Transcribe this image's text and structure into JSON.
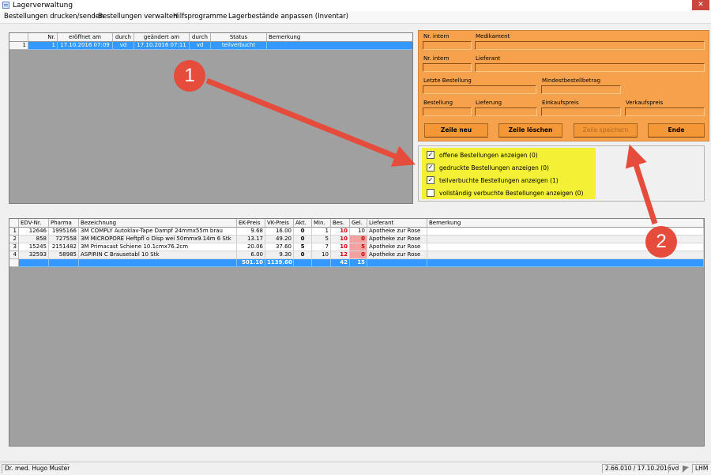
{
  "window": {
    "title": "Lagerverwaltung",
    "close_symbol": "✕"
  },
  "menu": [
    {
      "label": "Bestellungen drucken/senden"
    },
    {
      "label": "Bestellungen verwalten"
    },
    {
      "label": "Hilfsprogramme"
    },
    {
      "label": "Lagerbestände anpassen (Inventar)"
    }
  ],
  "orders_table": {
    "columns": [
      "Nr.",
      "eröffnet am",
      "durch",
      "geändert am",
      "durch",
      "Status",
      "Bemerkung"
    ],
    "rows": [
      {
        "idx": "1",
        "nr": "1",
        "opened": "17.10.2016 07:09",
        "by1": "vd",
        "changed": "17.10.2016 07:11",
        "by2": "vd",
        "status": "teilverbucht",
        "note": ""
      }
    ]
  },
  "form": {
    "labels": {
      "nr_intern_1": "Nr. intern",
      "medikament": "Medikament",
      "nr_intern_2": "Nr. intern",
      "lieferant": "Lieferant",
      "letzte_bestellung": "Letzte Bestellung",
      "mindestbestellbetrag": "Mindestbestellbetrag",
      "bestellung": "Bestellung",
      "lieferung": "Lieferung",
      "einkaufspreis": "Einkaufspreis",
      "verkaufspreis": "Verkaufspreis"
    },
    "buttons": {
      "zeile_neu": "Zeile neu",
      "zeile_loeschen": "Zeile löschen",
      "zeile_speichern": "Zeile speichern",
      "ende": "Ende"
    }
  },
  "filters": [
    {
      "label": "offene Bestellungen anzeigen (0)",
      "checked": true
    },
    {
      "label": "gedruckte Bestellungen anzeigen (0)",
      "checked": true
    },
    {
      "label": "teilverbuchte Bestellungen anzeigen (1)",
      "checked": true
    },
    {
      "label": "vollständig verbuchte Bestellungen anzeigen (0)",
      "checked": false
    }
  ],
  "items_table": {
    "columns": [
      "EDV-Nr.",
      "Pharma",
      "Bezeichnung",
      "EK-Preis",
      "VK-Preis",
      "Akt.",
      "Min.",
      "Bes.",
      "Gel.",
      "Lieferant",
      "Bemerkung"
    ],
    "rows": [
      {
        "idx": "1",
        "edv": "12646",
        "pharma": "1995166",
        "name": "3M COMPLY Autoklav-Tape Dampf 24mmx55m brau",
        "ek": "9.68",
        "vk": "16.00",
        "akt": "0",
        "min": "1",
        "bes": "10",
        "gel": "10",
        "lieferant": "Apotheke zur Rose",
        "note": ""
      },
      {
        "idx": "2",
        "edv": "858",
        "pharma": "727558",
        "name": "3M MICROPORE Heftpfl o Disp wei 50mmx9.14m 6 Stk",
        "ek": "13.17",
        "vk": "49.20",
        "akt": "0",
        "min": "5",
        "bes": "10",
        "gel": "0",
        "lieferant": "Apotheke zur Rose",
        "note": ""
      },
      {
        "idx": "3",
        "edv": "15245",
        "pharma": "2151482",
        "name": "3M Primacast Schiene 10.1cmx76.2cm",
        "ek": "20.06",
        "vk": "37.60",
        "akt": "5",
        "min": "7",
        "bes": "10",
        "gel": "5",
        "lieferant": "Apotheke zur Rose",
        "note": ""
      },
      {
        "idx": "4",
        "edv": "32593",
        "pharma": "58985",
        "name": "ASPIRIN C Brausetabl 10 Stk",
        "ek": "6.00",
        "vk": "9.30",
        "akt": "0",
        "min": "10",
        "bes": "12",
        "gel": "0",
        "lieferant": "Apotheke zur Rose",
        "note": ""
      }
    ],
    "totals": {
      "ek": "501.10",
      "vk": "1139.60",
      "bes": "42",
      "gel": "15"
    }
  },
  "annotations": {
    "badge1": "1",
    "badge2": "2"
  },
  "statusbar": {
    "user": "Dr. med. Hugo Muster",
    "version": "2.66.010 / 17.10.2016",
    "user_short": "vd",
    "code": "LHM"
  },
  "colors": {
    "accent_selection": "#3399ff",
    "form_panel": "#f6a24c",
    "filter_highlight": "#f4f036",
    "annotation": "#e64c3c",
    "negative_cell": "#f4a0a0"
  }
}
